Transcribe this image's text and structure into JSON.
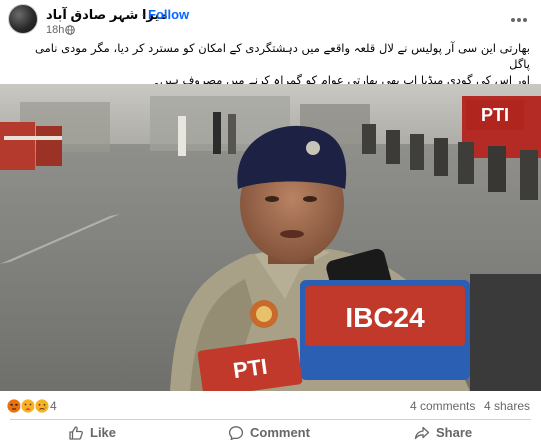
{
  "post": {
    "page_name": "میرا شہر صادق آباد",
    "separator": "·",
    "follow_label": "Follow",
    "timestamp": "18h",
    "text_line1": "بھارتی این سی آر پولیس نے لال قلعہ واقعے میں دہشتگردی کے امکان کو مسترد کر دیا، مگر مودی نامی پاگل",
    "text_line2": "اور اس کی گودی میڈیا اب بھی بھارتی عوام کو گمراہ کرنے میں مصروف ہیں۔"
  },
  "video": {
    "watermark_pti": "PTI",
    "mic_brand_left": "PTI",
    "mic_brand_right": "IBC24"
  },
  "stats": {
    "reactions_icons": [
      "angry",
      "care",
      "sad"
    ],
    "reactions_count": "4",
    "comments": "4 comments",
    "shares": "4 shares"
  },
  "actions": {
    "like": "Like",
    "comment": "Comment",
    "share": "Share"
  },
  "colors": {
    "accent": "#0866ff",
    "secondary_text": "#65676b",
    "mic_red": "#c0392b"
  }
}
